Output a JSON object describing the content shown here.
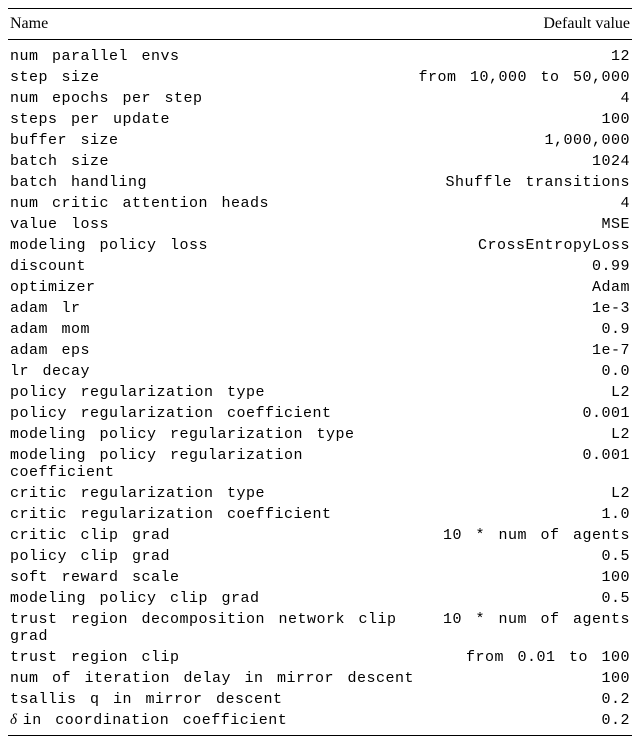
{
  "chart_data": {
    "type": "table",
    "columns": [
      "Name",
      "Default value"
    ],
    "rows": [
      {
        "name": "num parallel envs",
        "value": "12"
      },
      {
        "name": "step size",
        "value": "from 10,000 to 50,000"
      },
      {
        "name": "num epochs per step",
        "value": "4"
      },
      {
        "name": "steps per update",
        "value": "100"
      },
      {
        "name": "buffer size",
        "value": "1,000,000"
      },
      {
        "name": "batch size",
        "value": "1024"
      },
      {
        "name": "batch handling",
        "value": "Shuffle transitions"
      },
      {
        "name": "num critic attention heads",
        "value": "4"
      },
      {
        "name": "value loss",
        "value": "MSE"
      },
      {
        "name": "modeling policy loss",
        "value": "CrossEntropyLoss"
      },
      {
        "name": "discount",
        "value": "0.99"
      },
      {
        "name": "optimizer",
        "value": "Adam"
      },
      {
        "name": "adam lr",
        "value": "1e-3"
      },
      {
        "name": "adam mom",
        "value": "0.9"
      },
      {
        "name": "adam eps",
        "value": "1e-7"
      },
      {
        "name": "lr decay",
        "value": "0.0"
      },
      {
        "name": "policy regularization type",
        "value": "L2"
      },
      {
        "name": "policy regularization coefficient",
        "value": "0.001"
      },
      {
        "name": "modeling policy regularization type",
        "value": "L2"
      },
      {
        "name": "modeling policy regularization coefficient",
        "value": "0.001"
      },
      {
        "name": "critic regularization type",
        "value": "L2"
      },
      {
        "name": "critic regularization coefficient",
        "value": "1.0"
      },
      {
        "name": "critic clip grad",
        "value": "10 * num of agents"
      },
      {
        "name": "policy clip grad",
        "value": "0.5"
      },
      {
        "name": "soft reward scale",
        "value": "100"
      },
      {
        "name": "modeling policy clip grad",
        "value": "0.5"
      },
      {
        "name": "trust region decomposition network clip grad",
        "value": "10 * num of agents"
      },
      {
        "name": "trust region clip",
        "value": "from 0.01 to 100"
      },
      {
        "name": "num of iteration delay in mirror descent",
        "value": "100"
      },
      {
        "name": "tsallis q in mirror descent",
        "value": "0.2"
      },
      {
        "name": "δ in coordination coefficient",
        "value": "0.2"
      }
    ]
  },
  "headers": {
    "name": "Name",
    "value": "Default value"
  }
}
